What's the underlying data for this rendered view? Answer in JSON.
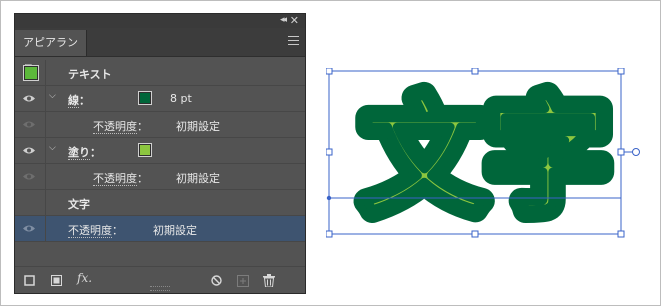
{
  "panel": {
    "tab_title": "アピアランス",
    "rows": {
      "object_label": "テキスト",
      "stroke_label": "線",
      "stroke_colon": "：",
      "stroke_value": "8 pt",
      "stroke_opacity_label": "不透明度",
      "stroke_opacity_colon": "：",
      "stroke_opacity_value": "初期設定",
      "fill_label": "塗り",
      "fill_colon": "：",
      "fill_opacity_label": "不透明度",
      "fill_opacity_colon": "：",
      "fill_opacity_value": "初期設定",
      "characters_label": "文字",
      "opacity_label": "不透明度",
      "opacity_colon": "：",
      "opacity_value": "初期設定"
    },
    "bottom": {
      "fx_label": "fx."
    }
  },
  "artwork": {
    "text": "文字"
  },
  "colors": {
    "stroke": "#00663a",
    "fill": "#8cc63f",
    "selection": "#3a63c8",
    "panel_bg": "#535353"
  }
}
